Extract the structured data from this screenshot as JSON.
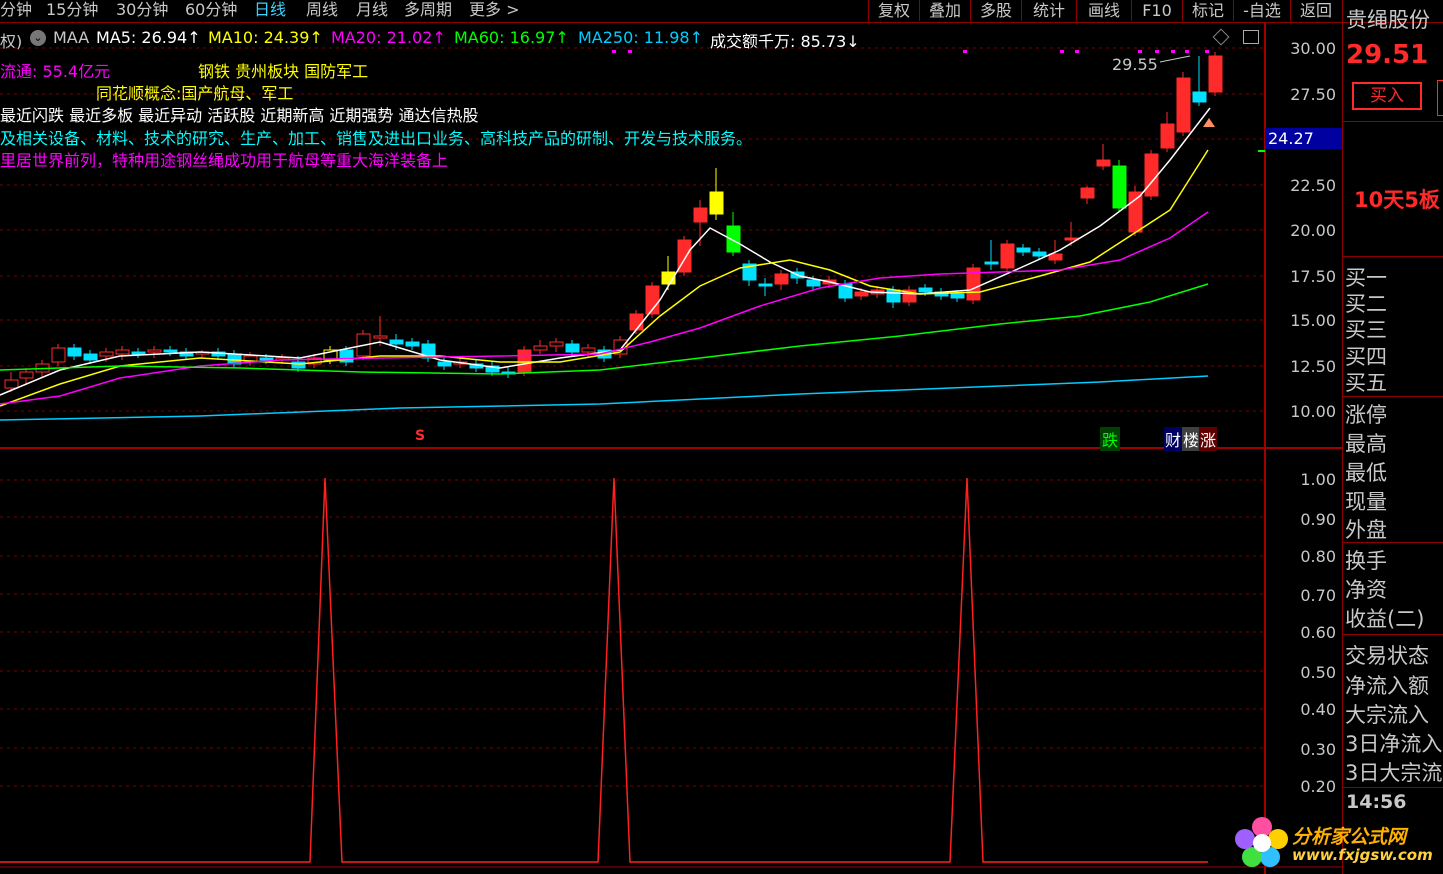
{
  "toolbar": {
    "timeframes": [
      "分钟",
      "15分钟",
      "30分钟",
      "60分钟",
      "日线",
      "周线",
      "月线",
      "多周期",
      "更多 >"
    ],
    "active_timeframe": "日线",
    "right_buttons": [
      "复权",
      "叠加",
      "多股",
      "统计",
      "画线",
      "F10",
      "标记",
      "-自选",
      "返回"
    ]
  },
  "ma_row": {
    "prefix": "权)",
    "maa": "MAA",
    "ma5": "MA5: 26.94↑",
    "ma10": "MA10: 24.39↑",
    "ma20": "MA20: 21.02↑",
    "ma60": "MA60: 16.97↑",
    "ma250": "MA250: 11.98↑",
    "volume": "成交额千万: 85.73↓"
  },
  "info": {
    "circulation": "流通: 55.4亿元",
    "sectors": "钢铁 贵州板块 国防军工",
    "concept": "同花顺概念:国产航母、军工",
    "tags": "最近闪跌 最近多板 最近异动 活跃股 近期新高 近期强势 通达信热股",
    "business": "及相关设备、材料、技术的研究、生产、加工、销售及进出口业务、高科技产品的研制、开发与技术服务。",
    "highlight": "里居世界前列，特种用途钢丝绳成功用于航母等重大海洋装备上"
  },
  "chart_labels": {
    "peak": "29.55",
    "current_price_marker": "24.27",
    "signal_s": "S",
    "label_die": "跌",
    "label_cai": "财",
    "label_lou": "楼",
    "label_zhang": "涨"
  },
  "price_axis": [
    "30.00",
    "27.50",
    "22.50",
    "20.00",
    "17.50",
    "15.00",
    "12.50",
    "10.00"
  ],
  "indicator_axis": [
    "1.00",
    "0.90",
    "0.80",
    "0.70",
    "0.60",
    "0.50",
    "0.40",
    "0.30",
    "0.20"
  ],
  "right_panel": {
    "stock_name": "贵绳股份",
    "price": "29.51",
    "buy_button": "买入",
    "streak": "10天5板",
    "bids": [
      "买一",
      "买二",
      "买三",
      "买四",
      "买五"
    ],
    "fields1": [
      "涨停",
      "最高",
      "最低",
      "现量",
      "外盘"
    ],
    "fields2": [
      "换手",
      "净资",
      "收益(二)"
    ],
    "fields3": [
      "交易状态",
      "净流入额",
      "大宗流入",
      "3日净流入",
      "3日大宗流"
    ],
    "time": "14:56"
  },
  "watermark": {
    "name": "分析家公式网",
    "url": "www.fxjgsw.com"
  },
  "colors": {
    "up": "#ff2a2a",
    "down": "#00e0ff",
    "ma5": "#ffffff",
    "ma10": "#ffff00",
    "ma20": "#ff00ff",
    "ma60": "#00ff00",
    "ma250": "#00ccff"
  }
}
